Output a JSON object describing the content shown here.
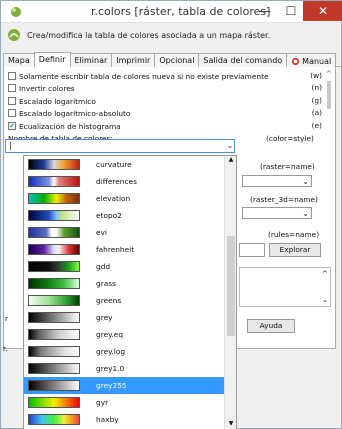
{
  "window": {
    "title": "r.colors [ráster, tabla de colores]",
    "min_glyph": "—",
    "max_glyph": "☐",
    "close_glyph": "✕"
  },
  "header": {
    "description": "Crea/modifica la tabla de colores asociada a un mapa ráster."
  },
  "tabs": [
    {
      "label": "Mapa",
      "active": false
    },
    {
      "label": "Definir",
      "active": true
    },
    {
      "label": "Eliminar",
      "active": false
    },
    {
      "label": "Imprimir",
      "active": false
    },
    {
      "label": "Opcional",
      "active": false
    },
    {
      "label": "Salida del comando",
      "active": false
    },
    {
      "label": "Manual",
      "active": false
    }
  ],
  "options": [
    {
      "label": "Solamente escribir tabla de colores nueva si no existe previamente",
      "flag": "(w)",
      "checked": false
    },
    {
      "label": "Invertir colores",
      "flag": "(n)",
      "checked": false
    },
    {
      "label": "Escalado logarítmico",
      "flag": "(g)",
      "checked": false
    },
    {
      "label": "Escalado logarítmico-absoluto",
      "flag": "(a)",
      "checked": false
    },
    {
      "label": "Ecualización de histograma",
      "flag": "(e)",
      "checked": true
    }
  ],
  "name_field": {
    "label": "Nombre de tabla de colores:",
    "flag": "(color=style)",
    "value": "|",
    "arrow": "⌄"
  },
  "right_side": {
    "raster_label": "(raster=name)",
    "raster3d_label": "(raster_3d=name)",
    "rules_label": "(rules=name)",
    "browse_label": "Explorar",
    "help_label": "Ayuda",
    "arrow": "⌄"
  },
  "dropdown": {
    "items": [
      {
        "name": "curvature",
        "selected": false
      },
      {
        "name": "differences",
        "selected": false
      },
      {
        "name": "elevation",
        "selected": false
      },
      {
        "name": "etopo2",
        "selected": false
      },
      {
        "name": "evi",
        "selected": false
      },
      {
        "name": "fahrenheit",
        "selected": false
      },
      {
        "name": "gdd",
        "selected": false
      },
      {
        "name": "grass",
        "selected": false
      },
      {
        "name": "greens",
        "selected": false
      },
      {
        "name": "grey",
        "selected": false
      },
      {
        "name": "grey.eq",
        "selected": false
      },
      {
        "name": "grey.log",
        "selected": false
      },
      {
        "name": "grey1.0",
        "selected": false
      },
      {
        "name": "grey255",
        "selected": true
      },
      {
        "name": "gyr",
        "selected": false
      },
      {
        "name": "haxby",
        "selected": false
      }
    ],
    "up_glyph": "▲",
    "down_glyph": "▼"
  },
  "left_edge": {
    "chars": [
      "r",
      "r."
    ]
  }
}
